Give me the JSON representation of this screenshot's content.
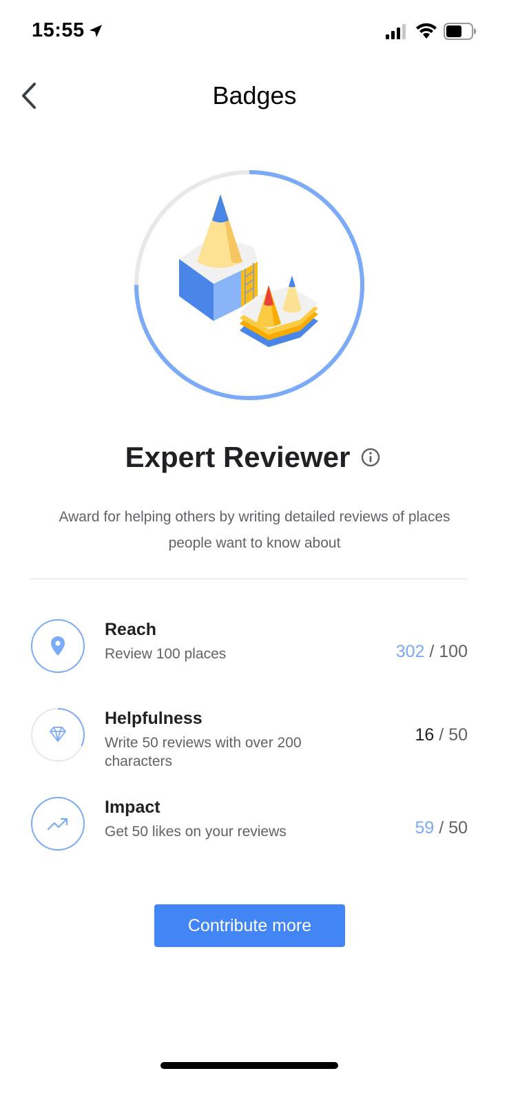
{
  "status_bar": {
    "time": "15:55"
  },
  "nav": {
    "title": "Badges"
  },
  "badge": {
    "title": "Expert Reviewer",
    "description": "Award for helping others by writing detailed reviews of places people want to know about",
    "progress_fraction": 0.75
  },
  "criteria": [
    {
      "name": "Reach",
      "description": "Review 100 places",
      "current": "302",
      "target": "100",
      "met": true,
      "icon": "location-pin-icon",
      "progress_fraction": 1.0
    },
    {
      "name": "Helpfulness",
      "description": "Write 50 reviews with over 200 characters",
      "current": "16",
      "target": "50",
      "met": false,
      "icon": "diamond-icon",
      "progress_fraction": 0.32
    },
    {
      "name": "Impact",
      "description": "Get 50 likes on your reviews",
      "current": "59",
      "target": "50",
      "met": true,
      "icon": "trending-up-icon",
      "progress_fraction": 1.0
    }
  ],
  "actions": {
    "contribute_label": "Contribute more"
  },
  "colors": {
    "accent": "#4285f4",
    "ring": "#7baaf7",
    "ring_track": "#e8e8e8"
  }
}
